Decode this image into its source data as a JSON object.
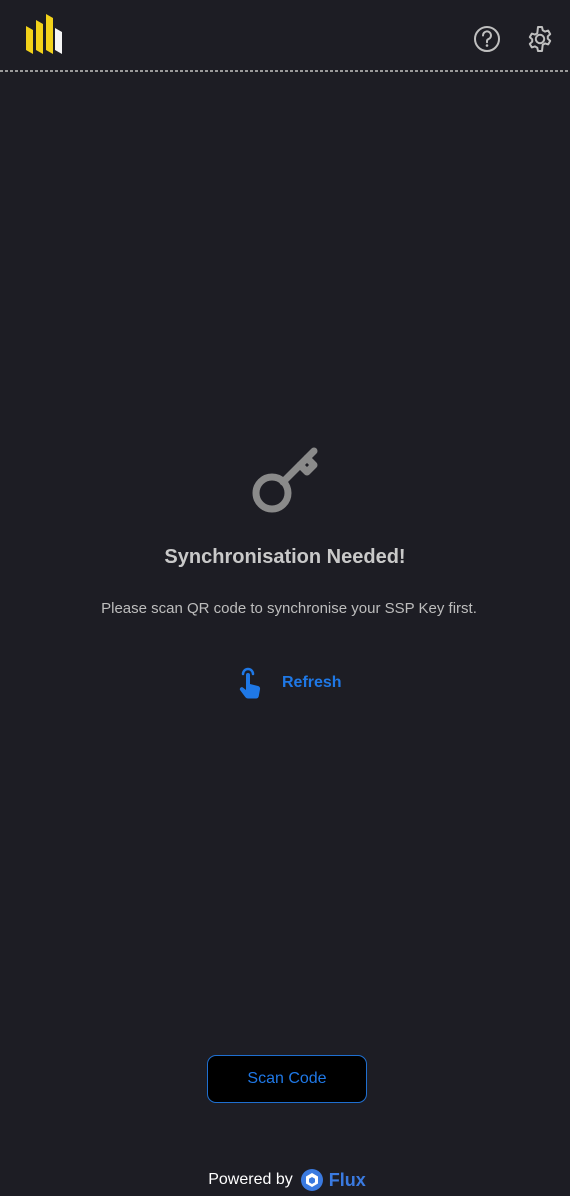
{
  "header": {
    "logo_icon": "ssp-logo-icon",
    "help_icon": "help-circle-icon",
    "settings_icon": "gear-icon"
  },
  "main": {
    "icon": "key-icon",
    "title": "Synchronisation Needed!",
    "subtitle": "Please scan QR code to synchronise your SSP Key first.",
    "refresh_label": "Refresh",
    "refresh_icon": "tap-finger-icon"
  },
  "actions": {
    "scan_label": "Scan Code"
  },
  "footer": {
    "powered_by": "Powered by",
    "brand_icon": "flux-logo-icon",
    "brand": "Flux"
  },
  "colors": {
    "background": "#1d1d24",
    "accent": "#1f78e6",
    "logo_yellow": "#f2d21a"
  }
}
